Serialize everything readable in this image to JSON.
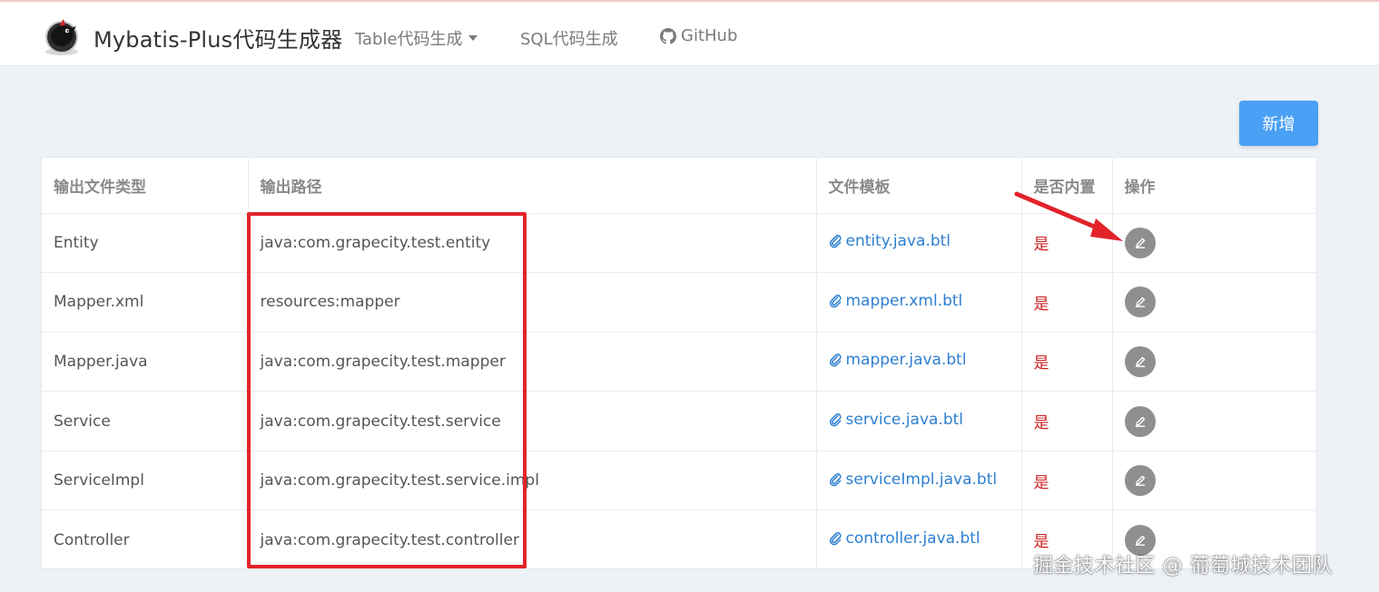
{
  "navbar": {
    "brand": "Mybatis-Plus代码生成器",
    "items": [
      {
        "label": "Table代码生成"
      },
      {
        "label": "SQL代码生成"
      },
      {
        "label": "GitHub"
      }
    ]
  },
  "toolbar": {
    "add_label": "新增"
  },
  "table": {
    "headers": [
      "输出文件类型",
      "输出路径",
      "文件模板",
      "是否内置",
      "操作"
    ],
    "rows": [
      {
        "type": "Entity",
        "path": "java:com.grapecity.test.entity",
        "template": "entity.java.btl",
        "builtin": "是"
      },
      {
        "type": "Mapper.xml",
        "path": "resources:mapper",
        "template": "mapper.xml.btl",
        "builtin": "是"
      },
      {
        "type": "Mapper.java",
        "path": "java:com.grapecity.test.mapper",
        "template": "mapper.java.btl",
        "builtin": "是"
      },
      {
        "type": "Service",
        "path": "java:com.grapecity.test.service",
        "template": "service.java.btl",
        "builtin": "是"
      },
      {
        "type": "ServiceImpl",
        "path": "java:com.grapecity.test.service.impl",
        "template": "serviceImpl.java.btl",
        "builtin": "是"
      },
      {
        "type": "Controller",
        "path": "java:com.grapecity.test.controller",
        "template": "controller.java.btl",
        "builtin": "是"
      }
    ]
  },
  "watermark": "掘金技术社区 @ 葡萄城技术团队",
  "colors": {
    "primary_button": "#4aa0f5",
    "link": "#2d7fd1",
    "builtin_text": "#cc1f1f",
    "annotation_red": "#e2232a",
    "edit_button": "#8f8f8f"
  },
  "icons": {
    "logo": "mybatis-bird-logo",
    "github": "github-icon",
    "template": "paperclip-icon",
    "edit": "pencil-icon"
  }
}
